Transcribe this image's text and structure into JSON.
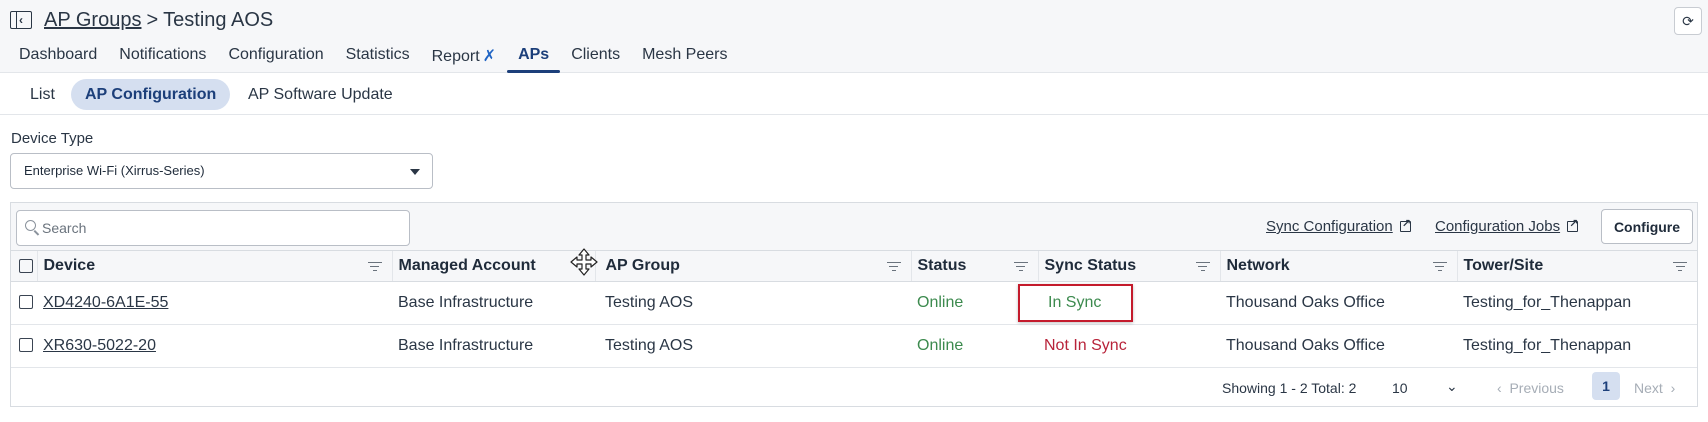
{
  "header": {
    "breadcrumb_parent": "AP Groups",
    "separator": ">",
    "title": "Testing AOS",
    "refresh_icon": "refresh-icon"
  },
  "tabs": [
    {
      "label": "Dashboard"
    },
    {
      "label": "Notifications"
    },
    {
      "label": "Configuration"
    },
    {
      "label": "Statistics"
    },
    {
      "label": "Report"
    },
    {
      "label": "APs",
      "active": true
    },
    {
      "label": "Clients"
    },
    {
      "label": "Mesh Peers"
    }
  ],
  "subtabs": [
    {
      "label": "List"
    },
    {
      "label": "AP Configuration",
      "active": true
    },
    {
      "label": "AP Software Update"
    }
  ],
  "device_type": {
    "label": "Device Type",
    "value": "Enterprise Wi-Fi (Xirrus-Series)"
  },
  "toolbar": {
    "search_placeholder": "Search",
    "sync_configuration": "Sync Configuration",
    "configuration_jobs": "Configuration Jobs",
    "configure": "Configure"
  },
  "table": {
    "columns": [
      "Device",
      "Managed Account",
      "AP Group",
      "Status",
      "Sync Status",
      "Network",
      "Tower/Site"
    ],
    "rows": [
      {
        "device": "XD4240-6A1E-55",
        "account": "Base Infrastructure",
        "group": "Testing AOS",
        "status": "Online",
        "sync": "In Sync",
        "network": "Thousand Oaks Office",
        "site": "Testing_for_Thenappan"
      },
      {
        "device": "XR630-5022-20",
        "account": "Base Infrastructure",
        "group": "Testing AOS",
        "status": "Online",
        "sync": "Not In Sync",
        "network": "Thousand Oaks Office",
        "site": "Testing_for_Thenappan"
      }
    ]
  },
  "pagination": {
    "info": "Showing 1 - 2 Total: 2",
    "page_size": "10",
    "previous": "Previous",
    "current_page": "1",
    "next": "Next"
  },
  "colors": {
    "accent": "#1c3f7a",
    "online": "#3c8a4e",
    "not_in_sync": "#b8233a",
    "highlight_box": "#c41b2c"
  }
}
